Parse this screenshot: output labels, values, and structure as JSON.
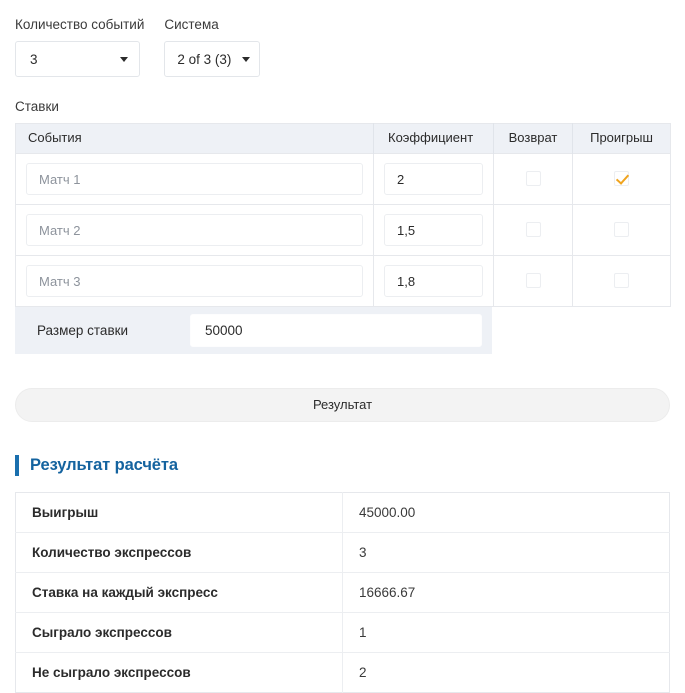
{
  "form": {
    "events_count": {
      "label": "Количество событий",
      "value": "3"
    },
    "system": {
      "label": "Система",
      "value": "2 of 3 (3)"
    },
    "bets_label": "Ставки"
  },
  "bets_table": {
    "headers": {
      "event": "События",
      "coefficient": "Коэффициент",
      "return": "Возврат",
      "loss": "Проигрыш"
    },
    "rows": [
      {
        "event_placeholder": "Матч 1",
        "event_value": "",
        "coefficient": "2",
        "return_checked": false,
        "loss_checked": true
      },
      {
        "event_placeholder": "Матч 2",
        "event_value": "",
        "coefficient": "1,5",
        "return_checked": false,
        "loss_checked": false
      },
      {
        "event_placeholder": "Матч 3",
        "event_value": "",
        "coefficient": "1,8",
        "return_checked": false,
        "loss_checked": false
      }
    ]
  },
  "stake": {
    "label": "Размер ставки",
    "value": "50000"
  },
  "actions": {
    "result_button": "Результат"
  },
  "result": {
    "heading": "Результат расчёта",
    "rows": [
      {
        "key": "Выигрыш",
        "value": "45000.00"
      },
      {
        "key": "Количество экспрессов",
        "value": "3"
      },
      {
        "key": "Ставка на каждый экспресс",
        "value": "16666.67"
      },
      {
        "key": "Сыграло экспрессов",
        "value": "1"
      },
      {
        "key": "Не сыграло экспрессов",
        "value": "2"
      }
    ]
  },
  "colors": {
    "accent_blue": "#14639f",
    "check_orange": "#f0a41e",
    "header_bg": "#eef1f6"
  }
}
